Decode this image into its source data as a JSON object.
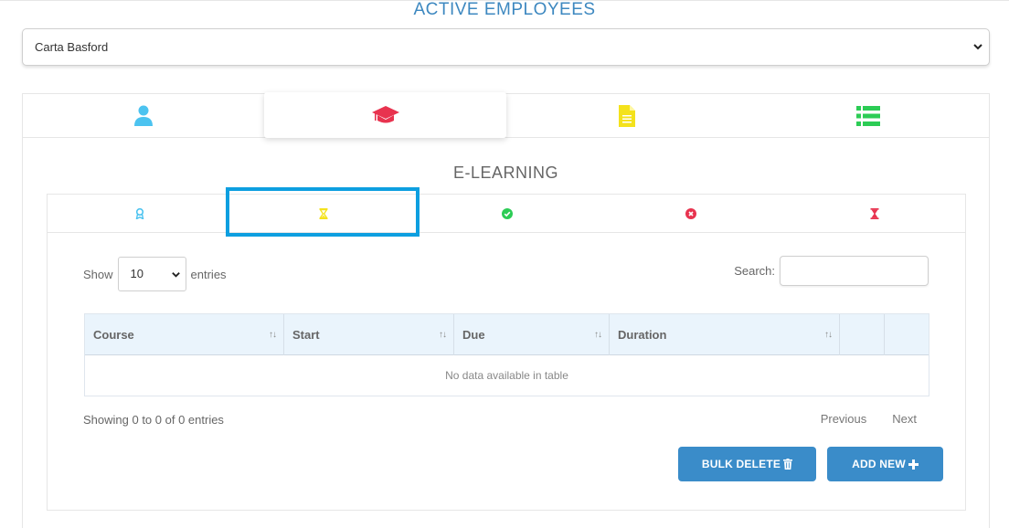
{
  "page": {
    "title": "ACTIVE EMPLOYEES",
    "employee_selected": "Carta Basford"
  },
  "main_tabs": [
    {
      "icon": "user-icon",
      "color": "#4cc3f0"
    },
    {
      "icon": "graduation-cap-icon",
      "color": "#e8334f",
      "active": true
    },
    {
      "icon": "document-icon",
      "color": "#f4e21c"
    },
    {
      "icon": "list-icon",
      "color": "#2ccc55"
    }
  ],
  "section": {
    "title": "E-LEARNING"
  },
  "sub_tabs": [
    {
      "icon": "award-icon",
      "color": "#4cc3f0"
    },
    {
      "icon": "hourglass-icon",
      "color": "#f4e21c",
      "highlighted": true
    },
    {
      "icon": "check-circle-icon",
      "color": "#2ccc55"
    },
    {
      "icon": "times-circle-icon",
      "color": "#e8334f"
    },
    {
      "icon": "hourglass-end-icon",
      "color": "#e8334f"
    }
  ],
  "table_controls": {
    "show_label": "Show",
    "entries_value": "10",
    "entries_label": "entries",
    "search_label": "Search:"
  },
  "table": {
    "columns": [
      "Course",
      "Start",
      "Due",
      "Duration",
      "",
      ""
    ],
    "empty_text": "No data available in table"
  },
  "footer": {
    "info": "Showing 0 to 0 of 0 entries",
    "previous": "Previous",
    "next": "Next"
  },
  "buttons": {
    "bulk_delete": "BULK DELETE",
    "add_new": "ADD NEW"
  },
  "colors": {
    "accent": "#3d88c0",
    "button": "#3a8cc9",
    "highlight": "#0d9fe0"
  }
}
